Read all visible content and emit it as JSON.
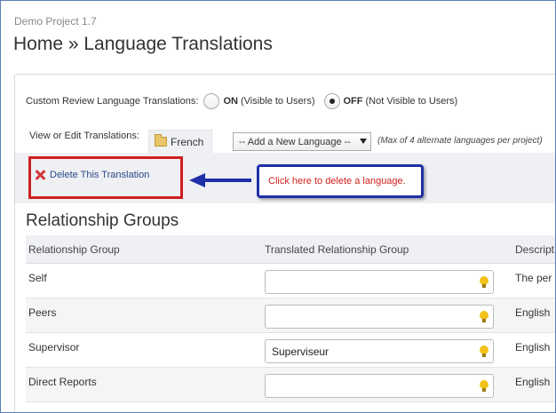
{
  "header": {
    "project_name": "Demo Project 1.7",
    "title": "Home » Language Translations"
  },
  "custom_review": {
    "label": "Custom Review Language Translations:",
    "on_label": "ON",
    "on_desc": "(Visible to Users)",
    "off_label": "OFF",
    "off_desc": "(Not Visible to Users)",
    "selected": "OFF"
  },
  "view_edit": {
    "label": "View or Edit Translations:",
    "current_tab": "French",
    "add_language_selected": "-- Add a New Language --",
    "max_note": "(Max of 4 alternate languages per project)"
  },
  "delete": {
    "label": "Delete This Translation"
  },
  "callout": {
    "text": "Click here to delete a language."
  },
  "colors": {
    "highlight_red": "#d0201f",
    "callout_blue": "#1f2fa8",
    "link_blue": "#2a4a8a"
  },
  "relationship_groups": {
    "title": "Relationship Groups",
    "columns": [
      "Relationship Group",
      "Translated Relationship Group",
      "Descript"
    ],
    "rows": [
      {
        "name": "Self",
        "translated": "",
        "description": "The per"
      },
      {
        "name": "Peers",
        "translated": "",
        "description": "English"
      },
      {
        "name": "Supervisor",
        "translated": "Superviseur",
        "description": "English"
      },
      {
        "name": "Direct Reports",
        "translated": "",
        "description": "English"
      }
    ]
  }
}
